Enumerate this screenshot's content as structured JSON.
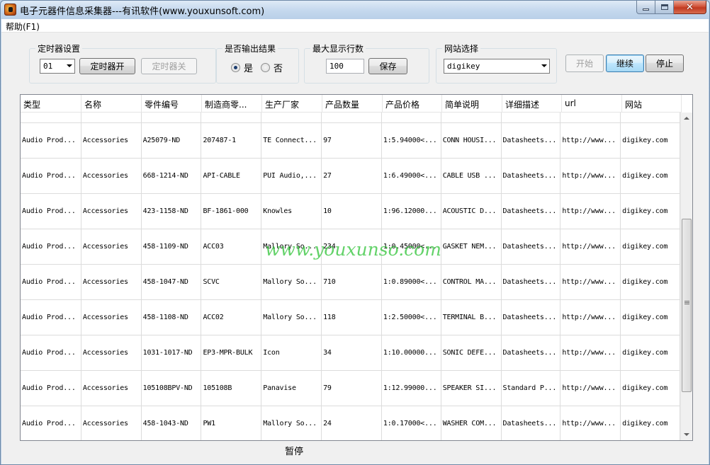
{
  "window": {
    "title": "电子元器件信息采集器---有讯软件(www.youxunsoft.com)",
    "close_glyph": "✕"
  },
  "menu": {
    "help": "帮助(F1)"
  },
  "timer": {
    "group_label": "定时器设置",
    "interval_value": "01",
    "start_button": "定时器开",
    "stop_button": "定时器关"
  },
  "output": {
    "group_label": "是否输出结果",
    "yes": "是",
    "no": "否",
    "selected": "是"
  },
  "max_rows": {
    "group_label": "最大显示行数",
    "value": "100",
    "save_button": "保存"
  },
  "site": {
    "group_label": "网站选择",
    "selected": "digikey"
  },
  "actions": {
    "start": "开始",
    "continue": "继续",
    "stop": "停止"
  },
  "table": {
    "columns": [
      "类型",
      "名称",
      "零件编号",
      "制造商零...",
      "生产厂家",
      "产品数量",
      "产品价格",
      "简单说明",
      "详细描述",
      "url",
      "网站"
    ],
    "rows": [
      [
        "Audio Prod...",
        "Accessories",
        "A25079-ND",
        "207487-1",
        "TE Connect...",
        "97",
        "1:5.94000<...",
        "CONN HOUSI...",
        "Datasheets...",
        "http://www...",
        "digikey.com"
      ],
      [
        "Audio Prod...",
        "Accessories",
        "668-1214-ND",
        "API-CABLE",
        "PUI Audio,...",
        "27",
        "1:6.49000<...",
        "CABLE USB ...",
        "Datasheets...",
        "http://www...",
        "digikey.com"
      ],
      [
        "Audio Prod...",
        "Accessories",
        "423-1158-ND",
        "BF-1861-000",
        "Knowles",
        "10",
        "1:96.12000...",
        "ACOUSTIC D...",
        "Datasheets...",
        "http://www...",
        "digikey.com"
      ],
      [
        "Audio Prod...",
        "Accessories",
        "458-1109-ND",
        "ACC03",
        "Mallory So...",
        "234",
        "1:0.45000<...",
        "GASKET NEM...",
        "Datasheets...",
        "http://www...",
        "digikey.com"
      ],
      [
        "Audio Prod...",
        "Accessories",
        "458-1047-ND",
        "SCVC",
        "Mallory So...",
        "710",
        "1:0.89000<...",
        "CONTROL MA...",
        "Datasheets...",
        "http://www...",
        "digikey.com"
      ],
      [
        "Audio Prod...",
        "Accessories",
        "458-1108-ND",
        "ACC02",
        "Mallory So...",
        "118",
        "1:2.50000<...",
        "TERMINAL B...",
        "Datasheets...",
        "http://www...",
        "digikey.com"
      ],
      [
        "Audio Prod...",
        "Accessories",
        "1031-1017-ND",
        "EP3-MPR-BULK",
        "Icon",
        "34",
        "1:10.00000...",
        "SONIC DEFE...",
        "Datasheets...",
        "http://www...",
        "digikey.com"
      ],
      [
        "Audio Prod...",
        "Accessories",
        "105108BPV-ND",
        "105108B",
        "Panavise",
        "79",
        "1:12.99000...",
        "SPEAKER SI...",
        "Standard P...",
        "http://www...",
        "digikey.com"
      ],
      [
        "Audio Prod...",
        "Accessories",
        "458-1043-ND",
        "PW1",
        "Mallory So...",
        "24",
        "1:0.17000<...",
        "WASHER COM...",
        "Datasheets...",
        "http://www...",
        "digikey.com"
      ]
    ]
  },
  "watermark": "www.youxunso.com",
  "status": "暂停"
}
